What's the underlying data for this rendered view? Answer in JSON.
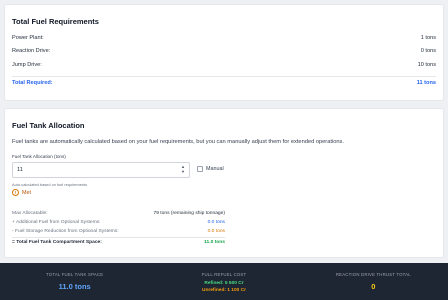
{
  "requirements": {
    "title": "Total Fuel Requirements",
    "rows": [
      {
        "label": "Power Plant:",
        "value": "1 tons"
      },
      {
        "label": "Reaction Drive:",
        "value": "0 tons"
      },
      {
        "label": "Jump Drive:",
        "value": "10 tons"
      }
    ],
    "total_label": "Total Required:",
    "total_value": "11 tons"
  },
  "allocation": {
    "title": "Fuel Tank Allocation",
    "description": "Fuel tanks are automatically calculated based on your fuel requirements, but you can manually adjust them for extended operations.",
    "field_label": "Fuel Tank Allocation (tons)",
    "field_value": "11",
    "manual_label": "Manual",
    "manual_checked": false,
    "auto_note": "Auto-calculated based on fuel requirements",
    "met_label": "Met",
    "calc": [
      {
        "label": "Max Allocatable:",
        "value": "79 tons (remaining ship tonnage)",
        "tone": "dark"
      },
      {
        "label": "+ Additional Fuel from Optional Systems:",
        "value": "0.0 tons",
        "tone": "blue"
      },
      {
        "label": "- Fuel Storage Reduction from Optional Systems:",
        "value": "0.0 tons",
        "tone": "orange"
      }
    ],
    "calc_total_label": "= Total Fuel Tank Compartment Space:",
    "calc_total_value": "11.0 tons"
  },
  "footer": {
    "tank_space_label": "TOTAL FUEL TANK SPACE",
    "tank_space_value": "11.0 tons",
    "refuel_label": "FULL REFUEL COST",
    "refined_value": "Refined: 5 500 Cr",
    "unrefined_value": "Unrefined: 1 100 Cr",
    "thrust_label": "REACTION DRIVE THRUST TOTAL",
    "thrust_value": "0"
  },
  "colors": {
    "accent_blue": "#2563eb",
    "light_blue": "#60a5fa",
    "green": "#16a34a",
    "light_green": "#4ade80",
    "orange": "#d97706",
    "yellow": "#facc15",
    "footer_bg": "#1e2533"
  },
  "icons": {
    "met": "alert-circle-icon",
    "select_arrows": "chevron-up-down-icon"
  }
}
